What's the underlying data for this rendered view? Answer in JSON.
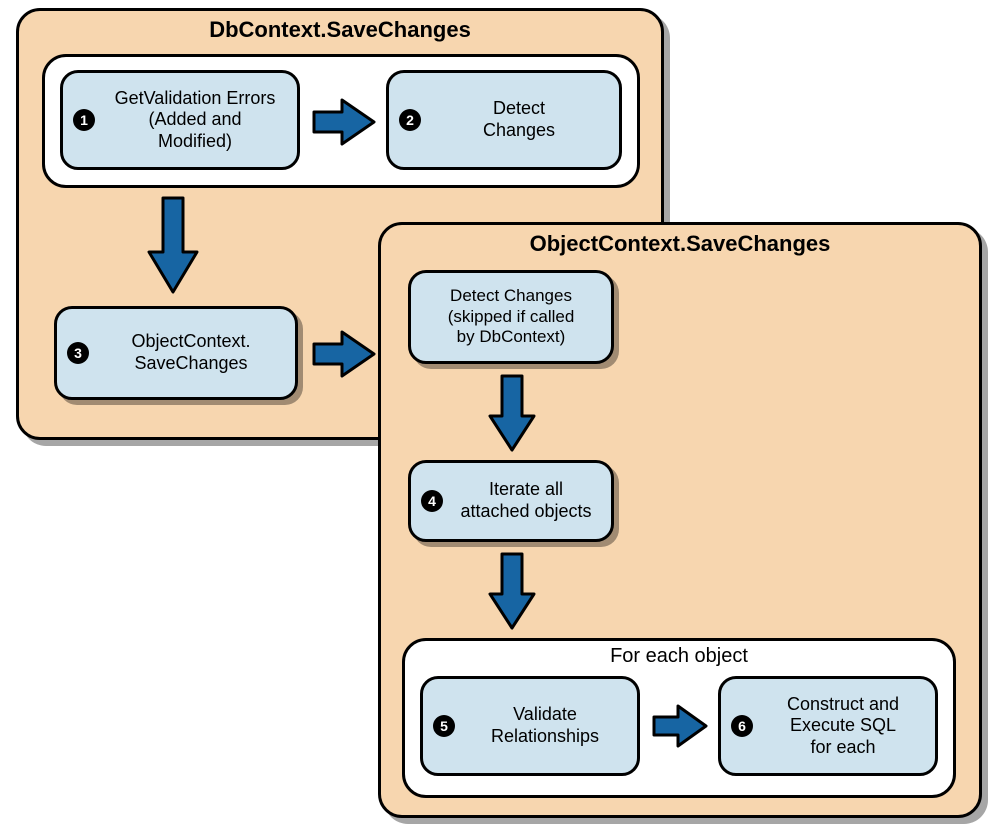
{
  "panel1": {
    "title": "DbContext.SaveChanges"
  },
  "panel2": {
    "title": "ObjectContext.SaveChanges"
  },
  "white1": {
    "title": ""
  },
  "white2": {
    "title": "For each object"
  },
  "steps": {
    "s1": {
      "num": "1",
      "text": "GetValidation Errors\n(Added and\nModified)"
    },
    "s2": {
      "num": "2",
      "text": "Detect\nChanges"
    },
    "s3": {
      "num": "3",
      "text": "ObjectContext.\nSaveChanges"
    },
    "s4a": {
      "text": "Detect Changes\n(skipped if called\nby DbContext)"
    },
    "s4": {
      "num": "4",
      "text": "Iterate all\nattached objects"
    },
    "s5": {
      "num": "5",
      "text": "Validate\nRelationships"
    },
    "s6": {
      "num": "6",
      "text": "Construct and\nExecute SQL\nfor each"
    }
  },
  "colors": {
    "panel": "#f7d6af",
    "step": "#cfe3ee",
    "arrow": "#1765a3",
    "arrowStroke": "#000000"
  }
}
